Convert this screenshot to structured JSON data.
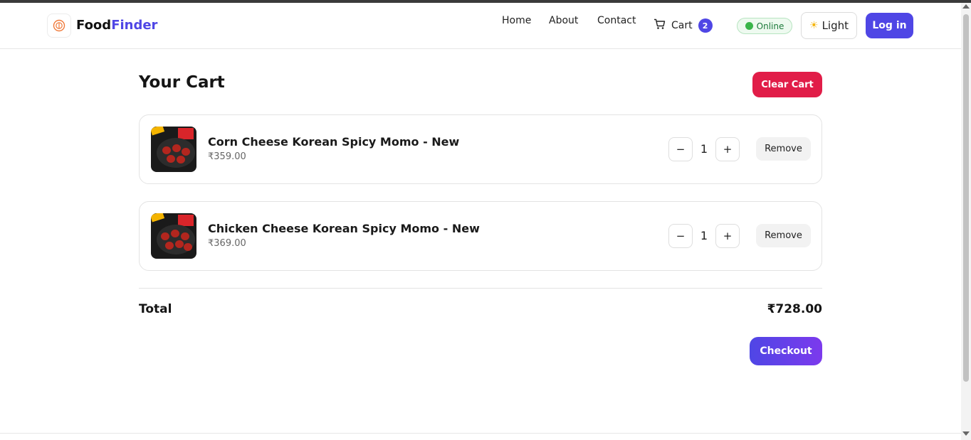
{
  "header": {
    "brand_primary": "Food",
    "brand_accent": "Finder",
    "nav": [
      {
        "label": "Home"
      },
      {
        "label": "About"
      },
      {
        "label": "Contact"
      }
    ],
    "cart_label": "Cart",
    "cart_count": "2",
    "status_label": "Online",
    "theme_label": "Light",
    "login_label": "Log in"
  },
  "cart": {
    "title": "Your Cart",
    "clear_label": "Clear Cart",
    "items": [
      {
        "name": "Corn Cheese Korean Spicy Momo - New",
        "price": "₹359.00",
        "quantity": "1",
        "minus": "−",
        "plus": "+",
        "remove_label": "Remove"
      },
      {
        "name": "Chicken Cheese Korean Spicy Momo - New",
        "price": "₹369.00",
        "quantity": "1",
        "minus": "−",
        "plus": "+",
        "remove_label": "Remove"
      }
    ],
    "total_label": "Total",
    "total_value": "₹728.00",
    "checkout_label": "Checkout"
  },
  "colors": {
    "accent": "#4f46e5",
    "danger": "#e11d48",
    "online": "#3ab54a"
  },
  "icons": {
    "logo": "food-finder-logo-icon",
    "cart": "cart-icon",
    "status": "green-dot-icon",
    "theme": "sun-icon"
  }
}
